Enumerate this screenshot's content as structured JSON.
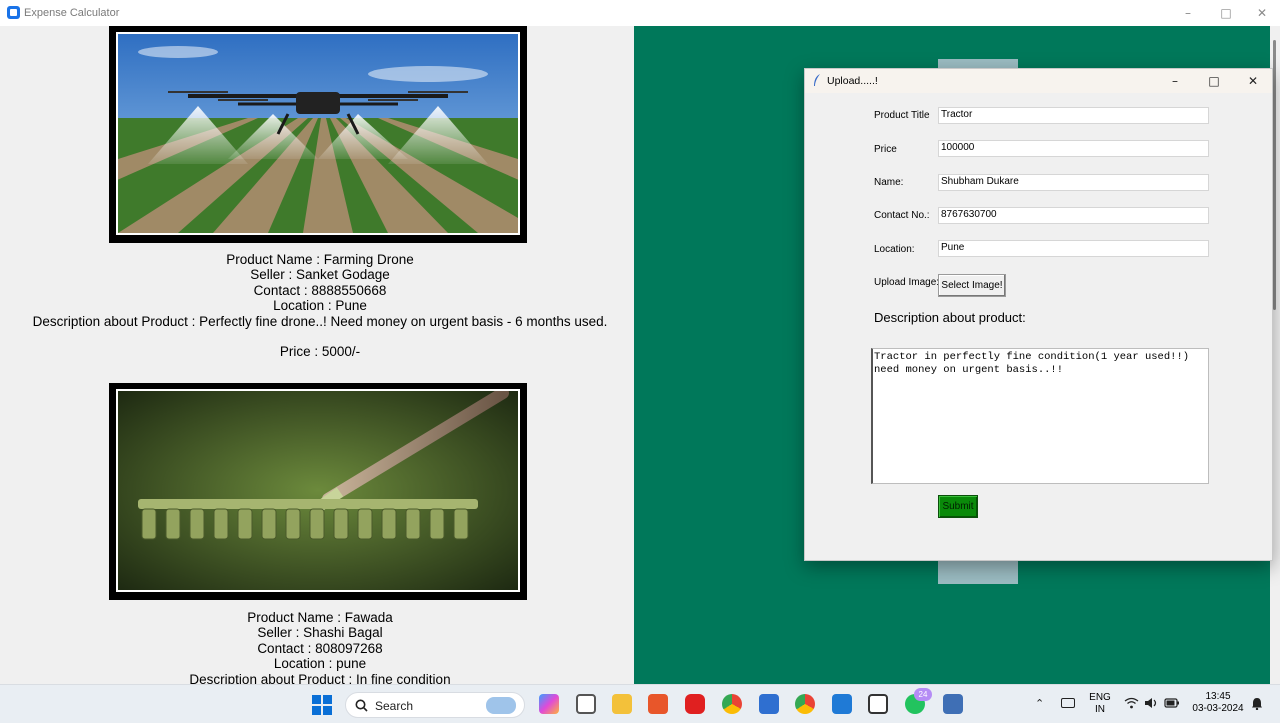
{
  "main_window": {
    "title": "Expense Calculator"
  },
  "products": [
    {
      "name_line": "Product Name : Farming Drone",
      "seller_line": "Seller : Sanket Godage",
      "contact_line": "Contact : 8888550668",
      "location_line": "Location : Pune",
      "description_line": "Description about Product : Perfectly fine drone..! Need money on urgent basis - 6 months used.",
      "price_line": "Price : 5000/-",
      "image": "farming-drone-photo"
    },
    {
      "name_line": "Product Name : Fawada",
      "seller_line": "Seller : Shashi Bagal",
      "contact_line": "Contact : 808097268",
      "location_line": "Location : pune",
      "description_line": "Description about Product : In fine condition",
      "image": "garden-rake-photo"
    }
  ],
  "upload_dialog": {
    "title": "Upload.....!",
    "fields": {
      "product_title_label": "Product Title",
      "product_title_value": "Tractor",
      "price_label": "Price",
      "price_value": "100000",
      "name_label": "Name:",
      "name_value": "Shubham Dukare",
      "contact_label": "Contact No.:",
      "contact_value": "8767630700",
      "location_label": "Location:",
      "location_value": "Pune",
      "upload_image_label": "Upload Image:"
    },
    "select_image_label": "Select Image!",
    "description_heading": "Description about product:",
    "description_text": "Tractor in perfectly fine condition(1 year used!!)\nneed money on urgent basis..!!",
    "submit_label": "Submit"
  },
  "taskbar": {
    "search_label": "Search",
    "language_line1": "ENG",
    "language_line2": "IN",
    "time": "13:45",
    "date": "03-03-2024",
    "whatsapp_badge": "24"
  },
  "colors": {
    "green_panel": "#00785a",
    "submit_button": "#0a8a0a",
    "windows_accent": "#1a73e8"
  },
  "icons": [
    "windows-start-icon",
    "search-icon",
    "copilot-icon",
    "task-view-icon",
    "file-explorer-icon",
    "app-icon",
    "youtube-icon",
    "chrome-icon",
    "notepad-icon",
    "chrome-profile-icon",
    "vscode-icon",
    "snipping-icon",
    "whatsapp-icon",
    "python-icon",
    "chevron-up-icon",
    "keyboard-icon",
    "wifi-icon",
    "volume-icon",
    "battery-icon",
    "bell-icon"
  ]
}
